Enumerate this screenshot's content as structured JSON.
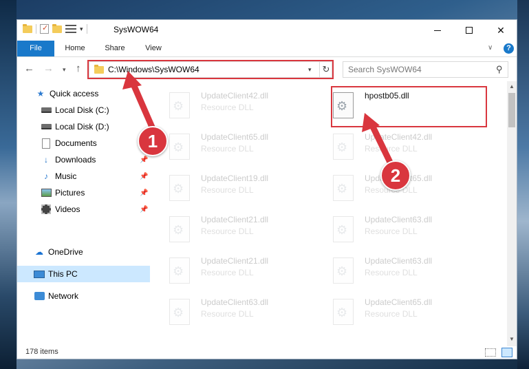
{
  "window": {
    "title": "SysWOW64",
    "ribbon_tabs": [
      "File",
      "Home",
      "Share",
      "View"
    ],
    "help_label": "?"
  },
  "address": {
    "path": "C:\\Windows\\SysWOW64",
    "search_placeholder": "Search SysWOW64"
  },
  "sidebar": {
    "items": [
      {
        "label": "Quick access",
        "icon": "star-icon"
      },
      {
        "label": "Local Disk (C:)",
        "icon": "drive-icon"
      },
      {
        "label": "Local Disk (D:)",
        "icon": "drive-icon"
      },
      {
        "label": "Documents",
        "icon": "documents-icon"
      },
      {
        "label": "Downloads",
        "icon": "download-icon"
      },
      {
        "label": "Music",
        "icon": "music-icon"
      },
      {
        "label": "Pictures",
        "icon": "pictures-icon"
      },
      {
        "label": "Videos",
        "icon": "videos-icon"
      },
      {
        "label": "OneDrive",
        "icon": "cloud-icon"
      },
      {
        "label": "This PC",
        "icon": "computer-icon"
      },
      {
        "label": "Network",
        "icon": "network-icon"
      }
    ]
  },
  "files": {
    "left": [
      {
        "name": "UpdateClient42.dll",
        "type": "Resource DLL"
      },
      {
        "name": "UpdateClient65.dll",
        "type": "Resource DLL"
      },
      {
        "name": "UpdateClient19.dll",
        "type": "Resource DLL"
      },
      {
        "name": "UpdateClient21.dll",
        "type": "Resource DLL"
      },
      {
        "name": "UpdateClient21.dll",
        "type": "Resource DLL"
      },
      {
        "name": "UpdateClient63.dll",
        "type": "Resource DLL"
      }
    ],
    "highlighted": {
      "name": "hpostb05.dll"
    },
    "right": [
      {
        "name": "UpdateClient42.dll",
        "type": "Resource DLL"
      },
      {
        "name": "UpdateClient65.dll",
        "type": "Resource DLL"
      },
      {
        "name": "UpdateClient63.dll",
        "type": "Resource DLL"
      },
      {
        "name": "UpdateClient63.dll",
        "type": "Resource DLL"
      },
      {
        "name": "UpdateClient65.dll",
        "type": "Resource DLL"
      }
    ]
  },
  "status": {
    "item_count": "178 items"
  },
  "callouts": {
    "one": "1",
    "two": "2"
  },
  "colors": {
    "accent": "#1979ca",
    "highlight": "#d9363e",
    "selection": "#cce8ff"
  }
}
